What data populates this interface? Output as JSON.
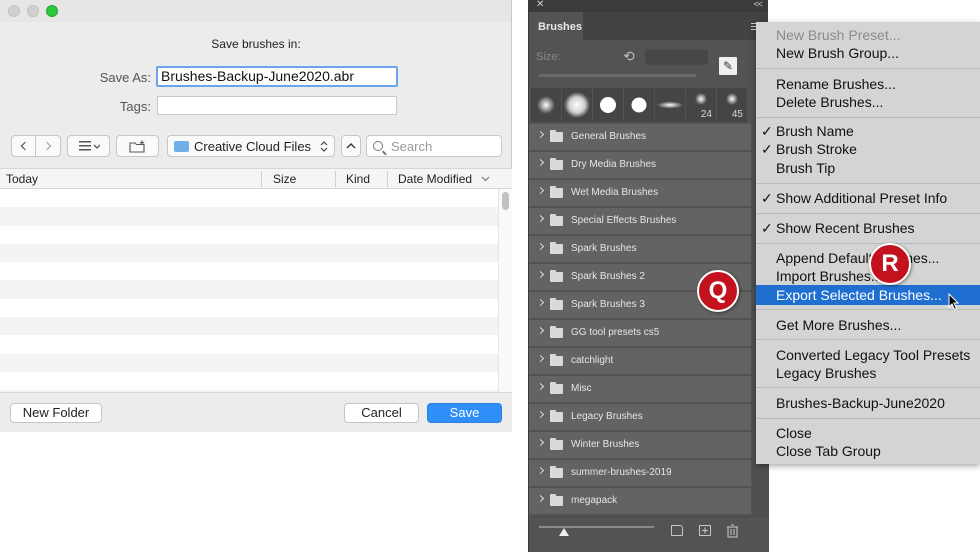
{
  "dialog": {
    "title": "Save brushes in:",
    "save_as_label": "Save As:",
    "save_as_value": "Brushes-Backup-June2020.abr",
    "tags_label": "Tags:",
    "location": "Creative Cloud Files",
    "search_placeholder": "Search",
    "columns": [
      "Today",
      "Size",
      "Kind",
      "Date Modified"
    ],
    "new_folder": "New Folder",
    "cancel": "Cancel",
    "save": "Save"
  },
  "panel": {
    "tab": "Brushes",
    "size_label": "Size:",
    "recent_counts": [
      "24",
      "45"
    ],
    "groups": [
      "General Brushes",
      "Dry Media Brushes",
      "Wet Media Brushes",
      "Special Effects Brushes",
      "Spark Brushes",
      "Spark Brushes 2",
      "Spark Brushes 3",
      "GG tool presets cs5",
      "catchlight",
      "Misc",
      "Legacy Brushes",
      "Winter Brushes",
      "summer-brushes-2019",
      "megapack"
    ]
  },
  "menu": {
    "items": {
      "new_preset": "New Brush Preset...",
      "new_group": "New Brush Group...",
      "rename": "Rename Brushes...",
      "delete": "Delete Brushes...",
      "brush_name": "Brush Name",
      "brush_stroke": "Brush Stroke",
      "brush_tip": "Brush Tip",
      "additional_info": "Show Additional Preset Info",
      "recent": "Show Recent Brushes",
      "append": "Append Default Brushes...",
      "import": "Import Brushes...",
      "export": "Export Selected Brushes...",
      "get_more": "Get More Brushes...",
      "converted": "Converted Legacy Tool Presets",
      "legacy": "Legacy Brushes",
      "backup": "Brushes-Backup-June2020",
      "close": "Close",
      "close_group": "Close Tab Group"
    }
  },
  "callouts": {
    "q": "Q",
    "r": "R"
  },
  "colors": {
    "highlight": "#1f6fd1",
    "badge": "#c3121e",
    "primary_button": "#2f8ff8"
  }
}
